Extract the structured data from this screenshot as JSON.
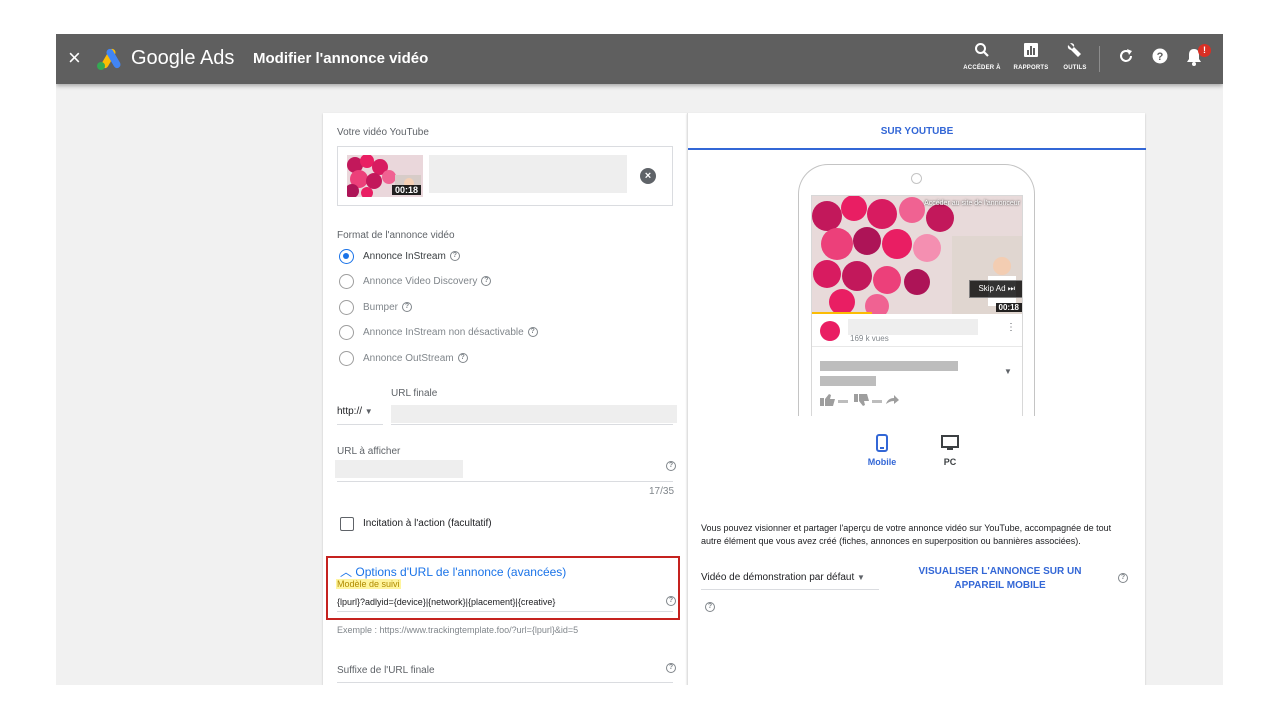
{
  "topbar": {
    "close": "×",
    "brand": "Google Ads",
    "title": "Modifier l'annonce vidéo",
    "actions": [
      {
        "label": "ACCÉDER À",
        "icon": "search-icon"
      },
      {
        "label": "RAPPORTS",
        "icon": "reports-icon"
      },
      {
        "label": "OUTILS",
        "icon": "wrench-icon"
      }
    ],
    "notif_badge": "!"
  },
  "left": {
    "video_label": "Votre vidéo YouTube",
    "video_duration": "00:18",
    "format_label": "Format de l'annonce vidéo",
    "formats": [
      {
        "label": "Annonce InStream",
        "selected": true
      },
      {
        "label": "Annonce Video Discovery",
        "selected": false
      },
      {
        "label": "Bumper",
        "selected": false
      },
      {
        "label": "Annonce InStream non désactivable",
        "selected": false
      },
      {
        "label": "Annonce OutStream",
        "selected": false
      }
    ],
    "final_url_label": "URL finale",
    "protocol": "http://",
    "display_url_label": "URL à afficher",
    "char_count": "17/35",
    "cta_label": "Incitation à l'action (facultatif)",
    "advanced_label": "Options d'URL de l'annonce (avancées)",
    "tracking_label": "Modèle de suivi",
    "tracking_value": "{lpurl}?adlyid={device}|{network}|{placement}|{creative}",
    "example": "Exemple : https://www.trackingtemplate.foo/?url={lpurl}&id=5",
    "suffix_label": "Suffixe de l'URL finale"
  },
  "right": {
    "tab": "SUR YOUTUBE",
    "video_link": "Accéder au site de l'annonceur",
    "skip": "Skip Ad ⏭",
    "video_duration": "00:18",
    "views": "169 k vues",
    "device_mobile": "Mobile",
    "device_pc": "PC",
    "description": "Vous pouvez visionner et partager l'aperçu de votre annonce vidéo sur YouTube, accompagnée de tout autre élément que vous avez créé (fiches, annonces en superposition ou bannières associées).",
    "demo_select": "Vidéo de démonstration par défaut",
    "mobile_link": "VISUALISER L'ANNONCE SUR UN APPAREIL MOBILE"
  },
  "colors": {
    "accent": "#3367d6",
    "topbar": "#5f5f5f",
    "highlight_box": "#c5221f"
  }
}
